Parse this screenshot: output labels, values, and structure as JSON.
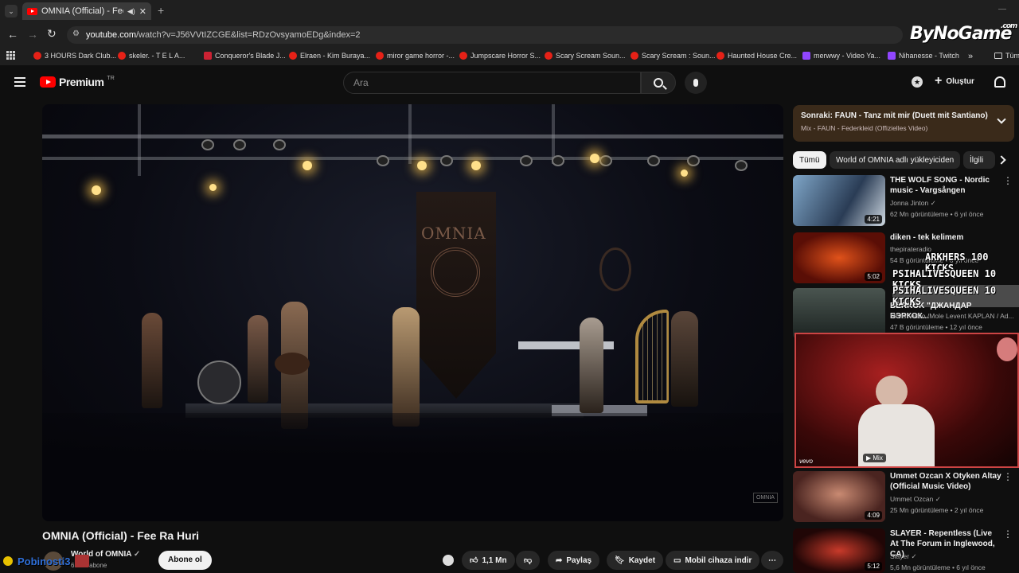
{
  "browser": {
    "tab_title": "OMNIA (Official) - Fee Ra Hu",
    "url_host": "youtube.com",
    "url_path": "/watch?v=J56VVtIZCGE&list=RDzOvsyamoEDg&index=2",
    "bookmarks": [
      {
        "label": "3 HOURS Dark Club...",
        "icon": "youtube-icon"
      },
      {
        "label": "skeler. - T E L A...",
        "icon": "youtube-icon"
      },
      {
        "label": "Conqueror's Blade J...",
        "icon": "game-icon"
      },
      {
        "label": "Elraen - Kim Buraya...",
        "icon": "youtube-icon"
      },
      {
        "label": "miror game horror -...",
        "icon": "youtube-icon"
      },
      {
        "label": "Jumpscare Horror S...",
        "icon": "youtube-icon"
      },
      {
        "label": "Scary Scream Soun...",
        "icon": "youtube-icon"
      },
      {
        "label": "Scary Scream : Soun...",
        "icon": "youtube-icon"
      },
      {
        "label": "Haunted House Cre...",
        "icon": "youtube-icon"
      },
      {
        "label": "merwwy - Video Ya...",
        "icon": "twitch-icon"
      },
      {
        "label": "Nihanesse - Twitch",
        "icon": "twitch-icon"
      }
    ],
    "bookmarks_more": "»",
    "bookmarks_folder": "Tüm"
  },
  "watermark": {
    "text": "ByNoGame",
    "sup": ".com"
  },
  "header": {
    "logo": "Premium",
    "logo_sup": "TR",
    "search_placeholder": "Ara",
    "create_label": "Oluştur"
  },
  "up_next": {
    "label": "Sonraki:",
    "title": "FAUN - Tanz mit mir (Duett mit Santiano)",
    "subtitle": "Mix - FAUN - Federkleid (Offizielles Video)"
  },
  "chips": [
    "Tümü",
    "World of OMNIA adlı yükleyiciden",
    "İlgili"
  ],
  "related": [
    {
      "title": "THE WOLF SONG - Nordic music - Vargsången",
      "channel": "Jonna Jinton",
      "verified": true,
      "meta": "62 Mn görüntüleme • 6 yıl önce",
      "duration": "4:21",
      "colors": [
        "#7fa6c8",
        "#2a3c55"
      ]
    },
    {
      "title": "diken - tek kelimem",
      "channel": "thepirateradio",
      "verified": false,
      "meta": "54 B görüntüleme • 6 yıl önce",
      "duration": "5:02",
      "colors": [
        "#e0521a",
        "#5a0e06"
      ]
    },
    {
      "title": "BERKOK \"ДЖАНДАР БЭРКОК...",
      "channel": "Молз Video /Mole Levent KAPLAN / Ad...",
      "verified": false,
      "meta": "47 B görüntüleme • 12 yıl önce",
      "duration": "",
      "colors": [
        "#4a5550",
        "#1b2220"
      ]
    },
    {
      "title": "Ummet Ozcan X Otyken  Altay (Official Music Video)",
      "channel": "Ummet Ozcan",
      "verified": true,
      "meta": "25 Mn görüntüleme • 2 yıl önce",
      "duration": "4:09",
      "colors": [
        "#c98a72",
        "#4a2420"
      ]
    },
    {
      "title": "SLAYER - Repentless (Live At The Forum in Inglewood, CA)",
      "channel": "Slayer",
      "verified": true,
      "meta": "5,6 Mn görüntüleme • 6 yıl önce",
      "duration": "5:12",
      "colors": [
        "#c83a2a",
        "#200606"
      ]
    }
  ],
  "stream_overlay": {
    "lines": [
      "ARKHERS 100 KICKS",
      "PSIHALIVESQUEEN 10 KICKS",
      "PSIHALIVESQUEEN 10 KICKS"
    ],
    "vevo": "vevo",
    "mix": "Mix"
  },
  "video": {
    "title": "OMNIA (Official) - Fee Ra Huri",
    "channel": "World of OMNIA",
    "subscribers": "659 B abone",
    "subscribe_label": "Abone ol",
    "likes": "1,1 Mn",
    "share_label": "Paylaş",
    "save_label": "Kaydet",
    "download_label": "Mobil cihaza indir",
    "stage_logo": "OMNIA",
    "corner_logo": "OMNIA"
  },
  "streamer_tag": "Pobinosti3",
  "colors": {
    "accent": "#ff0000",
    "up_next_bg": "#3a2a1a",
    "stage_light": "#ffe08a"
  }
}
